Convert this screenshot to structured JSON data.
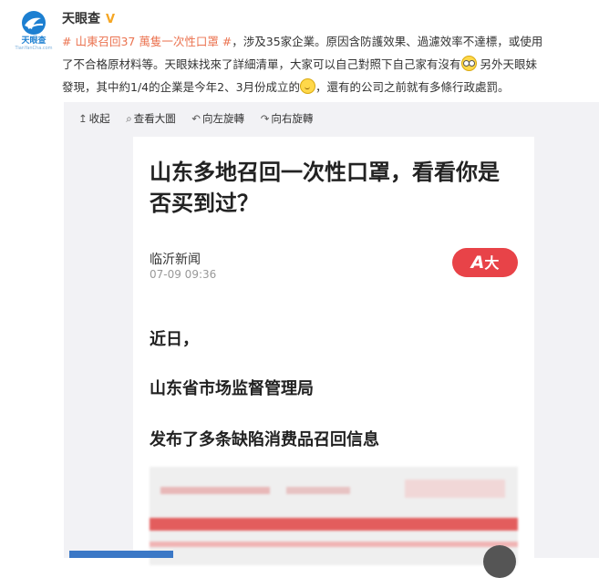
{
  "post": {
    "author": "天眼查",
    "logo_text": "天眼查",
    "logo_sub": "TianYanCha.com",
    "line1_tag": "# 山東召回37 萬隻一次性口罩 #",
    "line1_rest": "，涉及35家企業。原因含防護效果、過濾效率不達標，或使用",
    "line2": "了不合格原材料等。天眼妹找來了詳細清單，大家可以自己對照下自己家有沒有",
    "line2_after": " 另外天眼妹",
    "line3": "發現，其中約1/4的企業是今年2、3月份成立的",
    "line3_after": "，還有的公司之前就有多條行政處罰。"
  },
  "toolbar": {
    "collapse": "收起",
    "view_large": "查看大圖",
    "rotate_left": "向左旋轉",
    "rotate_right": "向右旋轉"
  },
  "article": {
    "title": "山东多地召回一次性口罩，看看你是否买到过？",
    "source": "临沂新闻",
    "time": "07-09 09:36",
    "font_button": "大",
    "lines": [
      "近日，",
      "山东省市场监督管理局",
      "发布了多条缺陷消费品召回信息"
    ]
  },
  "colors": {
    "tag": "#eb7350",
    "accent_red": "#e84348",
    "verified": "#f5a623"
  }
}
